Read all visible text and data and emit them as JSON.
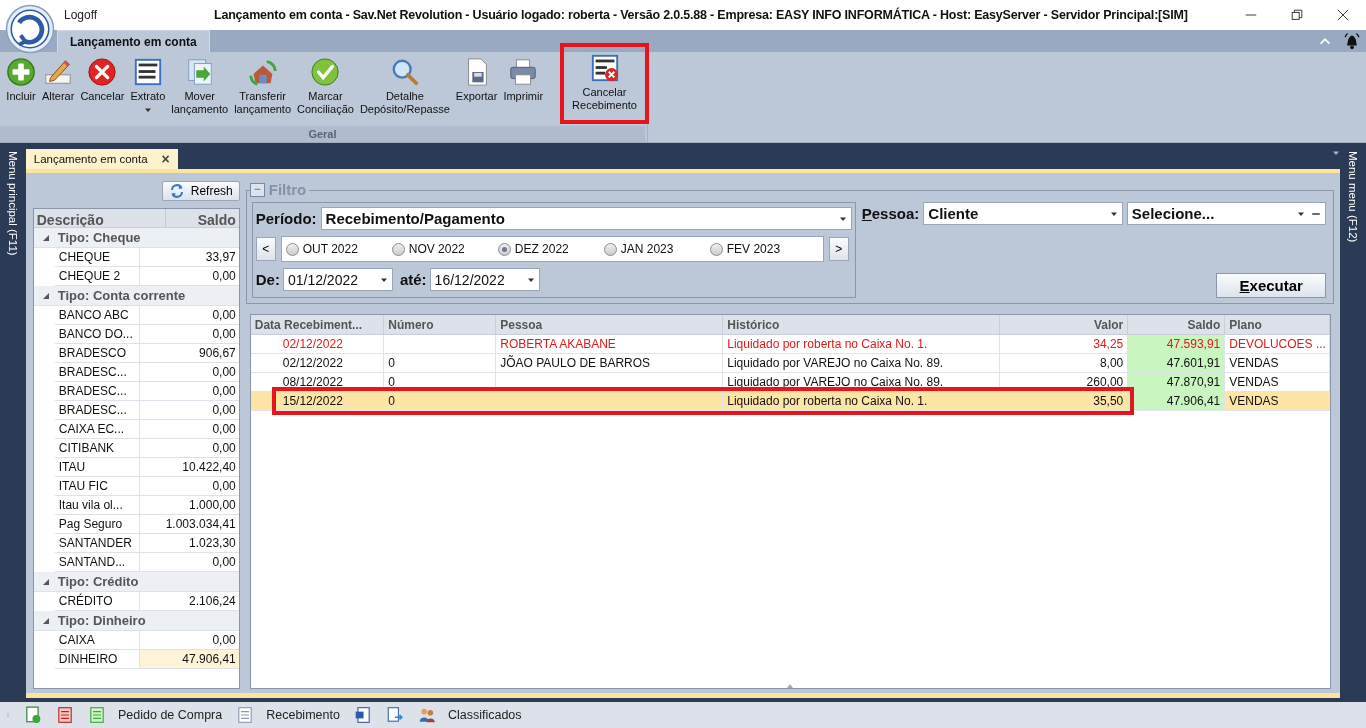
{
  "window": {
    "logoff": "Logoff",
    "title": "Lançamento em conta - Sav.Net Revolution - Usuário logado: roberta - Versão 2.0.5.88 - Empresa: EASY INFO INFORMÁTICA - Host: EasyServer - Servidor Principal:[SIM]"
  },
  "ribbon": {
    "tab": "Lançamento em conta",
    "group": "Geral",
    "buttons": [
      {
        "kind": "add",
        "label": "Incluir",
        "dropdown": false,
        "annotated": false
      },
      {
        "kind": "edit",
        "label": "Alterar",
        "dropdown": false,
        "annotated": false
      },
      {
        "kind": "cancel",
        "label": "Cancelar",
        "dropdown": false,
        "annotated": false
      },
      {
        "kind": "statement",
        "label": "Extrato",
        "dropdown": true,
        "annotated": false
      },
      {
        "kind": "move",
        "label": "Mover\nlançamento",
        "dropdown": false,
        "annotated": false
      },
      {
        "kind": "transfer",
        "label": "Transferir\nlançamento",
        "dropdown": false,
        "annotated": false
      },
      {
        "kind": "check",
        "label": "Marcar\nConciliação",
        "dropdown": false,
        "annotated": false
      },
      {
        "kind": "search",
        "label": "Detalhe\nDepósito/Repasse",
        "dropdown": false,
        "annotated": false
      },
      {
        "kind": "export",
        "label": "Exportar",
        "dropdown": false,
        "annotated": false
      },
      {
        "kind": "print",
        "label": "Imprimir",
        "dropdown": false,
        "annotated": false
      },
      {
        "kind": "statement-cancel",
        "label": "Cancelar\nRecebimento",
        "dropdown": false,
        "annotated": true
      }
    ]
  },
  "side_menus": {
    "left": "Menu principal (F11)",
    "right": "Menu menu (F12)"
  },
  "document_tab": {
    "label": "Lançamento em conta",
    "close": "×"
  },
  "accounts": {
    "refresh": "Refresh",
    "columns": [
      "Descrição",
      "Saldo"
    ],
    "groups": [
      {
        "label": "Tipo: Cheque",
        "expanded": true,
        "children": [
          {
            "name": "CHEQUE",
            "saldo": "33,97",
            "selected": false
          },
          {
            "name": "CHEQUE 2",
            "saldo": "0,00",
            "selected": false
          }
        ]
      },
      {
        "label": "Tipo: Conta corrente",
        "expanded": true,
        "children": [
          {
            "name": "BANCO ABC",
            "saldo": "0,00",
            "selected": false
          },
          {
            "name": "BANCO DO...",
            "saldo": "0,00",
            "selected": false
          },
          {
            "name": "BRADESCO",
            "saldo": "906,67",
            "selected": false
          },
          {
            "name": "BRADESC...",
            "saldo": "0,00",
            "selected": false
          },
          {
            "name": "BRADESC...",
            "saldo": "0,00",
            "selected": false
          },
          {
            "name": "BRADESC...",
            "saldo": "0,00",
            "selected": false
          },
          {
            "name": "CAIXA EC...",
            "saldo": "0,00",
            "selected": false
          },
          {
            "name": "CITIBANK",
            "saldo": "0,00",
            "selected": false
          },
          {
            "name": "ITAU",
            "saldo": "10.422,40",
            "selected": false
          },
          {
            "name": "ITAU FIC",
            "saldo": "0,00",
            "selected": false
          },
          {
            "name": "Itau vila ol...",
            "saldo": "1.000,00",
            "selected": false
          },
          {
            "name": "Pag Seguro",
            "saldo": "1.003.034,41",
            "selected": false
          },
          {
            "name": "SANTANDER",
            "saldo": "1.023,30",
            "selected": false
          },
          {
            "name": "SANTAND...",
            "saldo": "0,00",
            "selected": false
          }
        ]
      },
      {
        "label": "Tipo: Crédito",
        "expanded": true,
        "children": [
          {
            "name": "CRÉDITO",
            "saldo": "2.106,24",
            "selected": false
          }
        ]
      },
      {
        "label": "Tipo: Dinheiro",
        "expanded": true,
        "children": [
          {
            "name": "CAIXA",
            "saldo": "0,00",
            "selected": false
          },
          {
            "name": "DINHEIRO",
            "saldo": "47.906,41",
            "selected": true
          }
        ]
      }
    ]
  },
  "filter": {
    "title": "Filtro",
    "collapse": "−",
    "periodo_label": "Período:",
    "periodo": "Recebimento/Pagamento",
    "prev": "<",
    "next": ">",
    "months": [
      {
        "label": "OUT 2022",
        "selected": false
      },
      {
        "label": "NOV 2022",
        "selected": false
      },
      {
        "label": "DEZ 2022",
        "selected": true
      },
      {
        "label": "JAN 2023",
        "selected": false
      },
      {
        "label": "FEV 2023",
        "selected": false
      }
    ],
    "de_label": "De:",
    "de": "01/12/2022",
    "ate_label": "até:",
    "ate": "16/12/2022",
    "pessoa_label": "Pessoa:",
    "pessoa_tipo": "Cliente",
    "pessoa": "Selecione...",
    "execute": "Executar"
  },
  "table": {
    "columns": [
      "Data Recebiment...",
      "Número",
      "Pessoa",
      "Histórico",
      "Valor",
      "Saldo",
      "Plano"
    ],
    "rows": [
      {
        "cells": [
          "02/12/2022",
          "",
          "ROBERTA AKABANE",
          "Liquidado por roberta no Caixa No. 1.",
          "34,25",
          "47.593,91",
          "DEVOLUCOES ..."
        ],
        "alert": true,
        "selected": false,
        "annotated": false
      },
      {
        "cells": [
          "02/12/2022",
          "0",
          "JÕAO PAULO DE BARROS",
          "Liquidado por VAREJO no Caixa No. 89.",
          "8,00",
          "47.601,91",
          "VENDAS"
        ],
        "alert": false,
        "selected": false,
        "annotated": false
      },
      {
        "cells": [
          "08/12/2022",
          "0",
          "",
          "Liquidado por VAREJO no Caixa No. 89.",
          "260,00",
          "47.870,91",
          "VENDAS"
        ],
        "alert": false,
        "selected": false,
        "annotated": false
      },
      {
        "cells": [
          "15/12/2022",
          "0",
          "",
          "Liquidado por roberta no Caixa No. 1.",
          "35,50",
          "47.906,41",
          "VENDAS"
        ],
        "alert": false,
        "selected": true,
        "annotated": true
      }
    ]
  },
  "status_bar": [
    {
      "kind": "doc-dollar"
    },
    {
      "kind": "list-red"
    },
    {
      "kind": "list-green",
      "label": "Pedido de Compra"
    },
    {
      "kind": "doc",
      "label": "Recebimento"
    },
    {
      "kind": "word"
    },
    {
      "kind": "p-arrow"
    },
    {
      "kind": "people",
      "label": "Classificados"
    }
  ]
}
